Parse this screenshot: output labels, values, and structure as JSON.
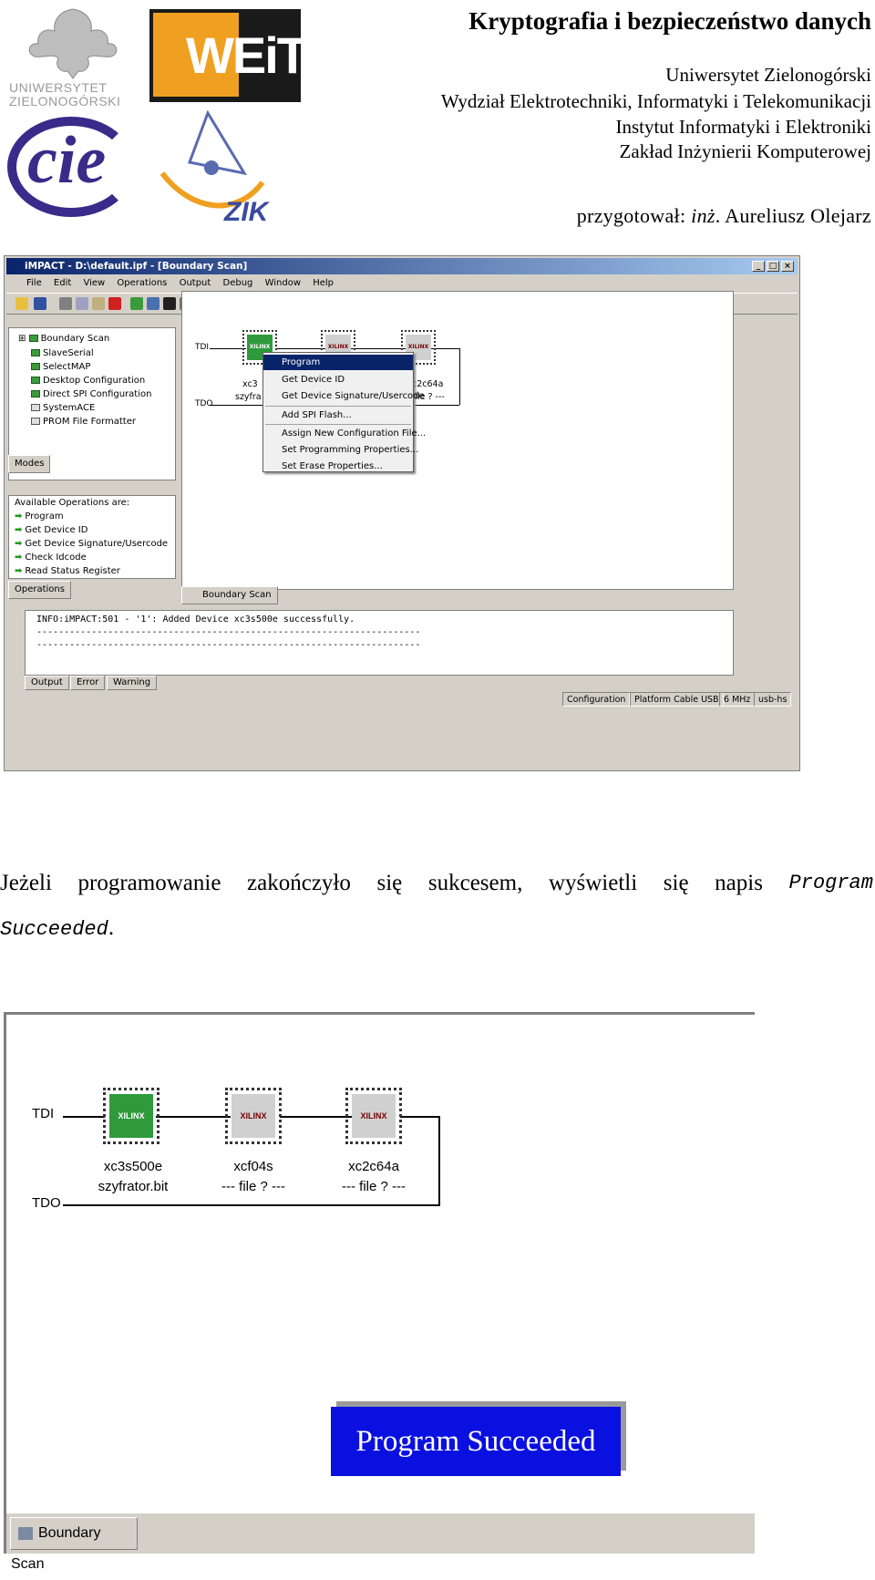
{
  "header": {
    "doc_title": "Kryptografia i bezpieczeństwo danych",
    "lines": [
      "Uniwersytet Zielonogórski",
      "Wydział Elektrotechniki, Informatyki i Telekomunikacji",
      "Instytut Informatyki i Elektroniki",
      "Zakład Inżynierii Komputerowej"
    ],
    "author_prefix": "przygotował: ",
    "author_title": "inż",
    "author_name": ". Aureliusz Olejarz",
    "logos": {
      "uz_text_1": "UNIWERSYTET",
      "uz_text_2": "ZIELONOGÓRSKI",
      "weit_text": "WEiT",
      "cie_text": "cie",
      "zik_text": "ZIK"
    }
  },
  "window": {
    "title": "iMPACT - D:\\default.ipf - [Boundary Scan]",
    "menu": [
      "File",
      "Edit",
      "View",
      "Operations",
      "Output",
      "Debug",
      "Window",
      "Help"
    ],
    "modes_tree": [
      "Boundary Scan",
      "SlaveSerial",
      "SelectMAP",
      "Desktop Configuration",
      "Direct SPI Configuration",
      "SystemACE",
      "PROM File Formatter"
    ],
    "modes_tab": "Modes",
    "ops_heading": "Available Operations are:",
    "ops": [
      "Program",
      "Get Device ID",
      "Get Device Signature/Usercode",
      "Check Idcode",
      "Read Status Register"
    ],
    "ops_tab": "Operations",
    "canvas": {
      "tdi": "TDI",
      "tdo": "TDO",
      "chip_brand": "XILINX",
      "chip1_label1": "xc3",
      "chip1_label2": "szyfra",
      "chip3_label1": "c2c64a",
      "chip3_label2": "file ? ---"
    },
    "context_menu": [
      "Program",
      "Get Device ID",
      "Get Device Signature/Usercode",
      "Add SPI Flash...",
      "Assign New Configuration File...",
      "Set Programming Properties...",
      "Set Erase Properties..."
    ],
    "view_tab": "Boundary Scan",
    "console_lines": [
      "INFO:iMPACT:501 - '1': Added Device xc3s500e successfully.",
      "----------------------------------------------------------------------",
      "----------------------------------------------------------------------"
    ],
    "console_tabs": [
      "Output",
      "Error",
      "Warning"
    ],
    "status": [
      "Configuration",
      "Platform Cable USB",
      "6 MHz",
      "usb-hs"
    ]
  },
  "paragraph": {
    "text_words": [
      "Jeżeli",
      "programowanie",
      "zakończyło",
      "się",
      "sukcesem,",
      "wyświetli",
      "się",
      "napis"
    ],
    "mono_1": "Program",
    "mono_2": "Succeeded",
    "trailing": "."
  },
  "shot2": {
    "tdi": "TDI",
    "tdo": "TDO",
    "chip_brand": "XILINX",
    "chips": [
      {
        "name": "xc3s500e",
        "file": "szyfrator.bit"
      },
      {
        "name": "xcf04s",
        "file": "--- file ? ---"
      },
      {
        "name": "xc2c64a",
        "file": "--- file ? ---"
      }
    ],
    "success_message": "Program Succeeded",
    "tab": "Boundary Scan"
  },
  "colors": {
    "selected_chip": "#2e9a3c",
    "unselected_chip": "#d0d0d0",
    "success_bg": "#0a10e0",
    "titlebar": "#0a246a"
  }
}
